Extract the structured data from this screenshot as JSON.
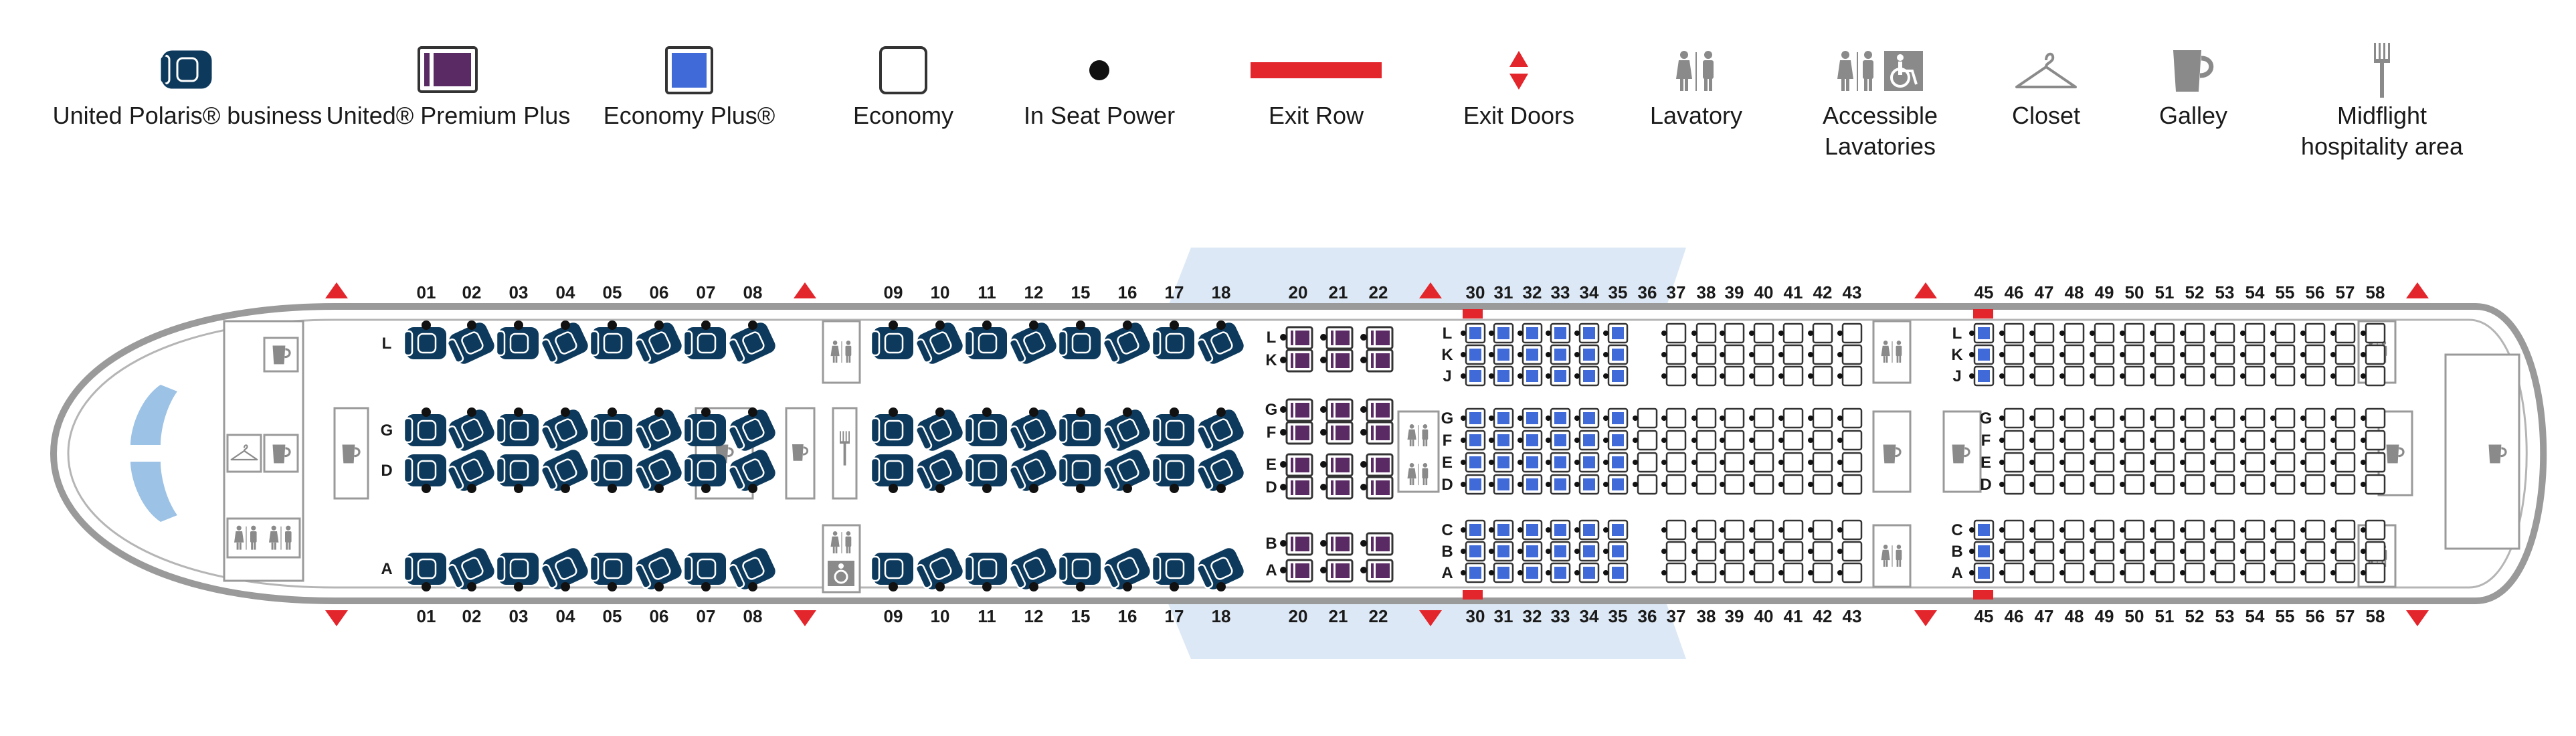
{
  "colors": {
    "polaris": "#0d3a5c",
    "premium_plus": "#5a2a64",
    "economy_plus": "#3f6ad8",
    "economy": "#ffffff",
    "exit_red": "#e3262c",
    "fuselage": "#9a9a9a",
    "icon_gray": "#8a8a8a",
    "wing": "#dce8f5"
  },
  "legend": [
    {
      "label": "United Polaris® business",
      "icon": "polaris-seat-icon"
    },
    {
      "label": "United® Premium Plus",
      "icon": "premium-plus-seat-icon"
    },
    {
      "label": "Economy Plus®",
      "icon": "economy-plus-seat-icon"
    },
    {
      "label": "Economy",
      "icon": "economy-seat-icon"
    },
    {
      "label": "In Seat Power",
      "icon": "power-dot-icon"
    },
    {
      "label": "Exit Row",
      "icon": "exit-row-bar-icon"
    },
    {
      "label": "Exit Doors",
      "icon": "exit-doors-arrows-icon"
    },
    {
      "label": "Lavatory",
      "icon": "lavatory-icon"
    },
    {
      "label": "Accessible Lavatories",
      "icon": "accessible-lavatory-icon"
    },
    {
      "label": "Closet",
      "icon": "closet-hanger-icon"
    },
    {
      "label": "Galley",
      "icon": "galley-cup-icon"
    },
    {
      "label": "Midflight hospitality area",
      "icon": "fork-icon"
    }
  ],
  "cabin": {
    "polaris_rows": [
      "01",
      "02",
      "03",
      "04",
      "05",
      "06",
      "07",
      "08",
      "09",
      "10",
      "11",
      "12",
      "15",
      "16",
      "17",
      "18"
    ],
    "polaris_letters_top": [
      "L"
    ],
    "polaris_letters_mid": [
      "G",
      "D"
    ],
    "polaris_letters_bottom": [
      "A"
    ],
    "premium_rows": [
      "20",
      "21",
      "22"
    ],
    "premium_letters_top": [
      "L",
      "K"
    ],
    "premium_letters_mid": [
      "G",
      "F",
      "E",
      "D"
    ],
    "premium_letters_bottom": [
      "B",
      "A"
    ],
    "economy_plus_rows": [
      "30",
      "31",
      "32",
      "33",
      "34",
      "35"
    ],
    "economy_front_rows": [
      "36",
      "37",
      "38",
      "39",
      "40",
      "41",
      "42",
      "43"
    ],
    "economy_rear_rows": [
      "45",
      "46",
      "47",
      "48",
      "49",
      "50",
      "51",
      "52",
      "53",
      "54",
      "55",
      "56",
      "57",
      "58"
    ],
    "economy_letters_top": [
      "L",
      "K",
      "J"
    ],
    "economy_letters_mid": [
      "G",
      "F",
      "E",
      "D"
    ],
    "economy_letters_bottom": [
      "C",
      "B",
      "A"
    ]
  }
}
